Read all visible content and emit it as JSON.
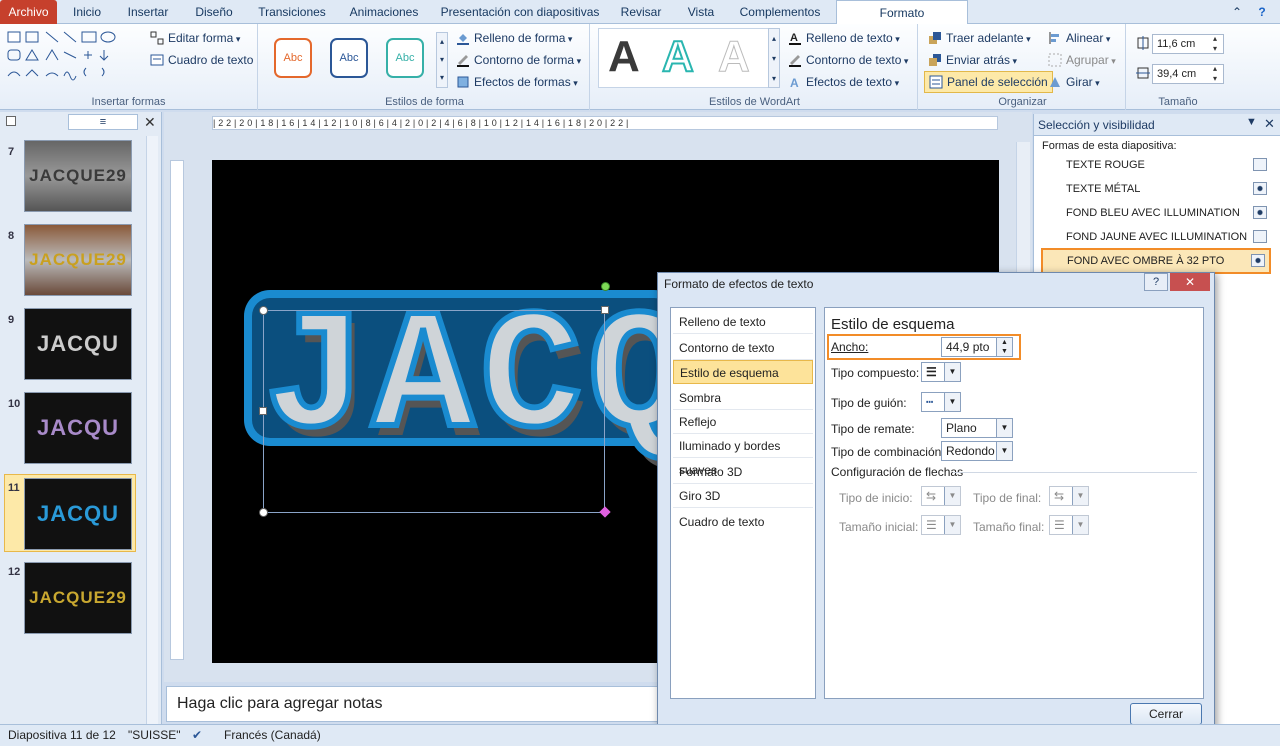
{
  "tabs": [
    "Archivo",
    "Inicio",
    "Insertar",
    "Diseño",
    "Transiciones",
    "Animaciones",
    "Presentación con diapositivas",
    "Revisar",
    "Vista",
    "Complementos",
    "Formato"
  ],
  "ribbon": {
    "insertar_formas": {
      "label": "Insertar formas",
      "editar_forma": "Editar forma",
      "cuadro_texto": "Cuadro de texto"
    },
    "estilos_forma": {
      "label": "Estilos de forma",
      "sample": "Abc",
      "relleno": "Relleno de forma",
      "contorno": "Contorno de forma",
      "efectos": "Efectos de formas"
    },
    "wordart": {
      "label": "Estilos de WordArt",
      "sample": "A",
      "relleno": "Relleno de texto",
      "contorno": "Contorno de texto",
      "efectos": "Efectos de texto"
    },
    "organizar": {
      "label": "Organizar",
      "traer": "Traer adelante",
      "enviar": "Enviar atrás",
      "panel": "Panel de selección",
      "alinear": "Alinear",
      "agrupar": "Agrupar",
      "girar": "Girar"
    },
    "tamano": {
      "label": "Tamaño",
      "alto": "11,6 cm",
      "ancho": "39,4 cm"
    }
  },
  "ruler": "|22|20|18|16|14|12|10|8|6|4|2|0|2|4|6|8|10|12|14|16|18|20|22|",
  "thumbnails": [
    {
      "num": "7",
      "text": "JACQUE29"
    },
    {
      "num": "8",
      "text": "JACQUE29"
    },
    {
      "num": "9",
      "text": "JACQU"
    },
    {
      "num": "10",
      "text": "JACQU"
    },
    {
      "num": "11",
      "text": "JACQU"
    },
    {
      "num": "12",
      "text": "JACQUE29"
    }
  ],
  "slide": {
    "wordart": "JACQU"
  },
  "notes": "Haga clic para agregar notas",
  "selection_pane": {
    "title": "Selección y visibilidad",
    "subtitle": "Formas de esta diapositiva:",
    "items": [
      "TEXTE ROUGE",
      "TEXTE MÉTAL",
      "FOND BLEU AVEC ILLUMINATION",
      "FOND JAUNE AVEC ILLUMINATION",
      "FOND AVEC OMBRE À 32 PTO"
    ]
  },
  "dialog": {
    "title": "Formato de efectos de texto",
    "nav": [
      "Relleno de texto",
      "Contorno de texto",
      "Estilo de esquema",
      "Sombra",
      "Reflejo",
      "Iluminado y bordes suaves",
      "Formato 3D",
      "Giro 3D",
      "Cuadro de texto"
    ],
    "section": "Estilo de esquema",
    "ancho_label": "Ancho:",
    "ancho_value": "44,9 pto",
    "tipo_compuesto": "Tipo compuesto:",
    "tipo_guion": "Tipo de guión:",
    "tipo_remate": "Tipo de remate:",
    "remate_value": "Plano",
    "tipo_combinacion": "Tipo de combinación:",
    "combinacion_value": "Redondo",
    "flechas": "Configuración de flechas",
    "tipo_inicio": "Tipo de inicio:",
    "tipo_final": "Tipo de final:",
    "tamano_inicial": "Tamaño inicial:",
    "tamano_final": "Tamaño final:",
    "close": "Cerrar"
  },
  "status": {
    "slide": "Diapositiva 11 de 12",
    "theme": "\"SUISSE\"",
    "lang": "Francés (Canadá)"
  },
  "colors": {
    "accent": "#f28c28",
    "file_tab": "#c6402c",
    "wordart_blue": "#1a8bd0"
  }
}
